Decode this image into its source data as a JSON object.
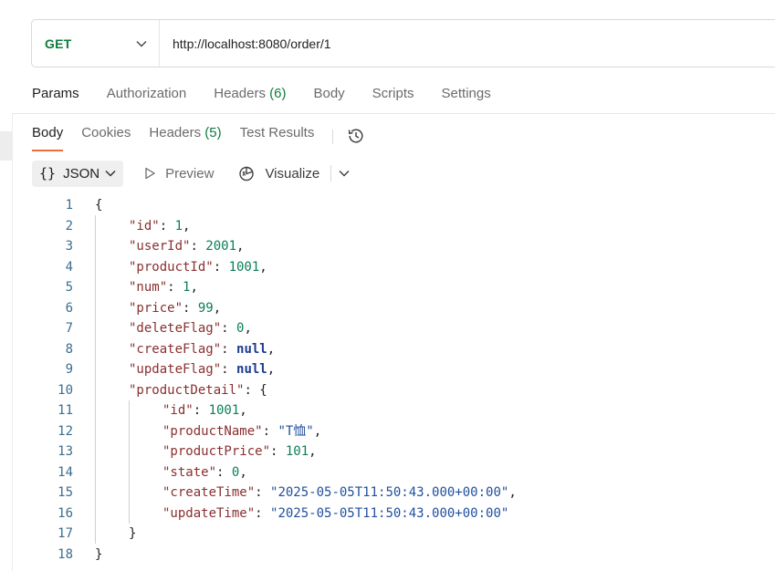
{
  "request": {
    "method": "GET",
    "url": "http://localhost:8080/order/1"
  },
  "request_tabs": [
    {
      "label": "Params"
    },
    {
      "label": "Authorization"
    },
    {
      "label": "Headers",
      "count": "(6)"
    },
    {
      "label": "Body"
    },
    {
      "label": "Scripts"
    },
    {
      "label": "Settings"
    }
  ],
  "response_tabs": [
    {
      "label": "Body"
    },
    {
      "label": "Cookies"
    },
    {
      "label": "Headers",
      "count": "(5)"
    },
    {
      "label": "Test Results"
    }
  ],
  "view_bar": {
    "format_braces": "{}",
    "format_label": "JSON",
    "preview_label": "Preview",
    "visualize_label": "Visualize"
  },
  "icons": {
    "method_dropdown": "chevron-down-icon",
    "history": "history-icon",
    "preview": "play-icon",
    "visualize": "visualize-icon"
  },
  "colors": {
    "method_get": "#0f7b3c",
    "active_tab_underline": "#f26b3a",
    "json_key": "#8a2f2f",
    "json_number": "#0a7e5a",
    "json_string": "#1f4f9e",
    "json_null": "#1a3d8f"
  },
  "code_lines": [
    {
      "n": "1",
      "tokens": [
        [
          "pun",
          "{"
        ]
      ]
    },
    {
      "n": "2",
      "tokens": [
        [
          "key",
          "\"id\""
        ],
        [
          "pun",
          ": "
        ],
        [
          "num",
          "1"
        ],
        [
          "pun",
          ","
        ]
      ]
    },
    {
      "n": "3",
      "tokens": [
        [
          "key",
          "\"userId\""
        ],
        [
          "pun",
          ": "
        ],
        [
          "num",
          "2001"
        ],
        [
          "pun",
          ","
        ]
      ]
    },
    {
      "n": "4",
      "tokens": [
        [
          "key",
          "\"productId\""
        ],
        [
          "pun",
          ": "
        ],
        [
          "num",
          "1001"
        ],
        [
          "pun",
          ","
        ]
      ]
    },
    {
      "n": "5",
      "tokens": [
        [
          "key",
          "\"num\""
        ],
        [
          "pun",
          ": "
        ],
        [
          "num",
          "1"
        ],
        [
          "pun",
          ","
        ]
      ]
    },
    {
      "n": "6",
      "tokens": [
        [
          "key",
          "\"price\""
        ],
        [
          "pun",
          ": "
        ],
        [
          "num",
          "99"
        ],
        [
          "pun",
          ","
        ]
      ]
    },
    {
      "n": "7",
      "tokens": [
        [
          "key",
          "\"deleteFlag\""
        ],
        [
          "pun",
          ": "
        ],
        [
          "num",
          "0"
        ],
        [
          "pun",
          ","
        ]
      ]
    },
    {
      "n": "8",
      "tokens": [
        [
          "key",
          "\"createFlag\""
        ],
        [
          "pun",
          ": "
        ],
        [
          "kw",
          "null"
        ],
        [
          "pun",
          ","
        ]
      ]
    },
    {
      "n": "9",
      "tokens": [
        [
          "key",
          "\"updateFlag\""
        ],
        [
          "pun",
          ": "
        ],
        [
          "kw",
          "null"
        ],
        [
          "pun",
          ","
        ]
      ]
    },
    {
      "n": "10",
      "tokens": [
        [
          "key",
          "\"productDetail\""
        ],
        [
          "pun",
          ": {"
        ]
      ]
    },
    {
      "n": "11",
      "tokens": [
        [
          "key",
          "\"id\""
        ],
        [
          "pun",
          ": "
        ],
        [
          "num",
          "1001"
        ],
        [
          "pun",
          ","
        ]
      ]
    },
    {
      "n": "12",
      "tokens": [
        [
          "key",
          "\"productName\""
        ],
        [
          "pun",
          ": "
        ],
        [
          "str",
          "\"T恤\""
        ],
        [
          "pun",
          ","
        ]
      ]
    },
    {
      "n": "13",
      "tokens": [
        [
          "key",
          "\"productPrice\""
        ],
        [
          "pun",
          ": "
        ],
        [
          "num",
          "101"
        ],
        [
          "pun",
          ","
        ]
      ]
    },
    {
      "n": "14",
      "tokens": [
        [
          "key",
          "\"state\""
        ],
        [
          "pun",
          ": "
        ],
        [
          "num",
          "0"
        ],
        [
          "pun",
          ","
        ]
      ]
    },
    {
      "n": "15",
      "tokens": [
        [
          "key",
          "\"createTime\""
        ],
        [
          "pun",
          ": "
        ],
        [
          "str",
          "\"2025-05-05T11:50:43.000+00:00\""
        ],
        [
          "pun",
          ","
        ]
      ]
    },
    {
      "n": "16",
      "tokens": [
        [
          "key",
          "\"updateTime\""
        ],
        [
          "pun",
          ": "
        ],
        [
          "str",
          "\"2025-05-05T11:50:43.000+00:00\""
        ]
      ]
    },
    {
      "n": "17",
      "tokens": [
        [
          "pun",
          "}"
        ]
      ]
    },
    {
      "n": "18",
      "tokens": [
        [
          "pun",
          "}"
        ]
      ]
    }
  ]
}
